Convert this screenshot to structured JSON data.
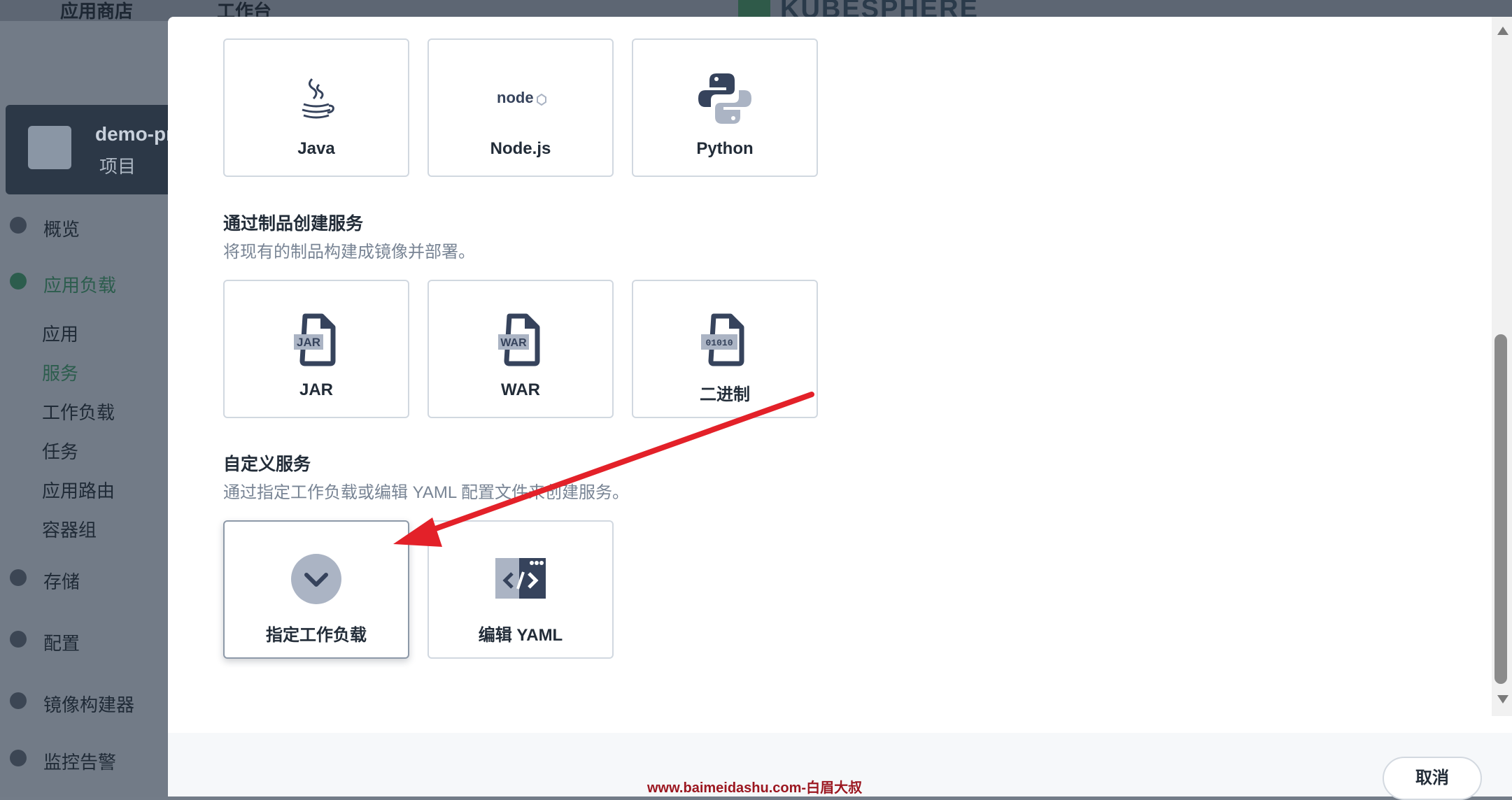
{
  "background_app": {
    "topbar": {
      "app_store": "应用商店",
      "workbench": "工作台",
      "brand": "KUBESPHERE"
    },
    "project": {
      "name": "demo-pr",
      "type": "项目"
    },
    "nav": {
      "overview": "概览",
      "app_workloads": "应用负载",
      "apps": "应用",
      "services": "服务",
      "workloads": "工作负载",
      "jobs": "任务",
      "ingress": "应用路由",
      "pods": "容器组",
      "storage": "存储",
      "config": "配置",
      "image_builder": "镜像构建器",
      "monitoring": "监控告警"
    }
  },
  "modal": {
    "language_cards": [
      {
        "label": "Java",
        "icon": "java-icon"
      },
      {
        "label": "Node.js",
        "icon": "nodejs-icon"
      },
      {
        "label": "Python",
        "icon": "python-icon"
      }
    ],
    "artifact_section": {
      "title": "通过制品创建服务",
      "description": "将现有的制品构建成镜像并部署。",
      "cards": [
        {
          "label": "JAR",
          "icon": "jar-file-icon",
          "badge": "JAR"
        },
        {
          "label": "WAR",
          "icon": "war-file-icon",
          "badge": "WAR"
        },
        {
          "label": "二进制",
          "icon": "binary-file-icon",
          "badge": "01010"
        }
      ]
    },
    "custom_section": {
      "title": "自定义服务",
      "description": "通过指定工作负载或编辑 YAML 配置文件来创建服务。",
      "cards": [
        {
          "label": "指定工作负载",
          "icon": "check-circle-icon",
          "selected": true
        },
        {
          "label": "编辑 YAML",
          "icon": "code-editor-icon",
          "selected": false
        }
      ]
    },
    "footer": {
      "cancel_label": "取消",
      "watermark": "www.baimeidashu.com-白眉大叔"
    }
  },
  "colors": {
    "card_border": "#d1d8e0",
    "icon_dark": "#36435c",
    "icon_light": "#abb4c4",
    "annotation_arrow": "#e32129",
    "watermark": "#9b1720"
  }
}
